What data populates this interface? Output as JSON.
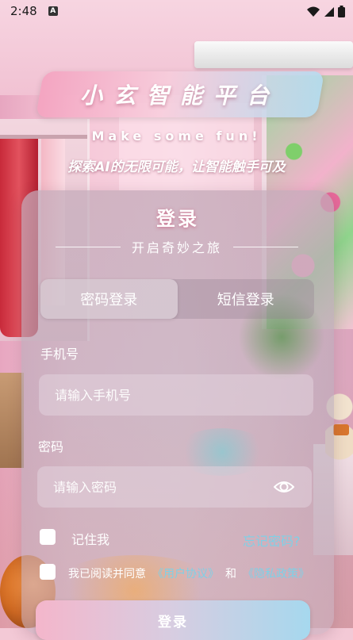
{
  "status_bar": {
    "time": "2:48",
    "notification_badge": "A"
  },
  "header": {
    "app_title": "小玄智能平台",
    "subtitle_en": "Make some fun!",
    "subtitle_cn": "探索AI的无限可能，让智能触手可及"
  },
  "login": {
    "title": "登录",
    "subtitle": "开启奇妙之旅",
    "tabs": [
      {
        "label": "密码登录",
        "active": true
      },
      {
        "label": "短信登录",
        "active": false
      }
    ],
    "phone": {
      "label": "手机号",
      "placeholder": "请输入手机号"
    },
    "password": {
      "label": "密码",
      "placeholder": "请输入密码"
    },
    "remember_label": "记住我",
    "forgot_label": "忘记密码?",
    "agreement": {
      "prefix": "我已阅读并同意",
      "user_agreement": "《用户协议》",
      "and": "和",
      "privacy_policy": "《隐私政策》"
    },
    "submit_label": "登录"
  },
  "colors": {
    "accent_link": "#7fd0e6",
    "title_gradient_start": "#f4a3c0",
    "title_gradient_end": "#b4dcf0"
  }
}
